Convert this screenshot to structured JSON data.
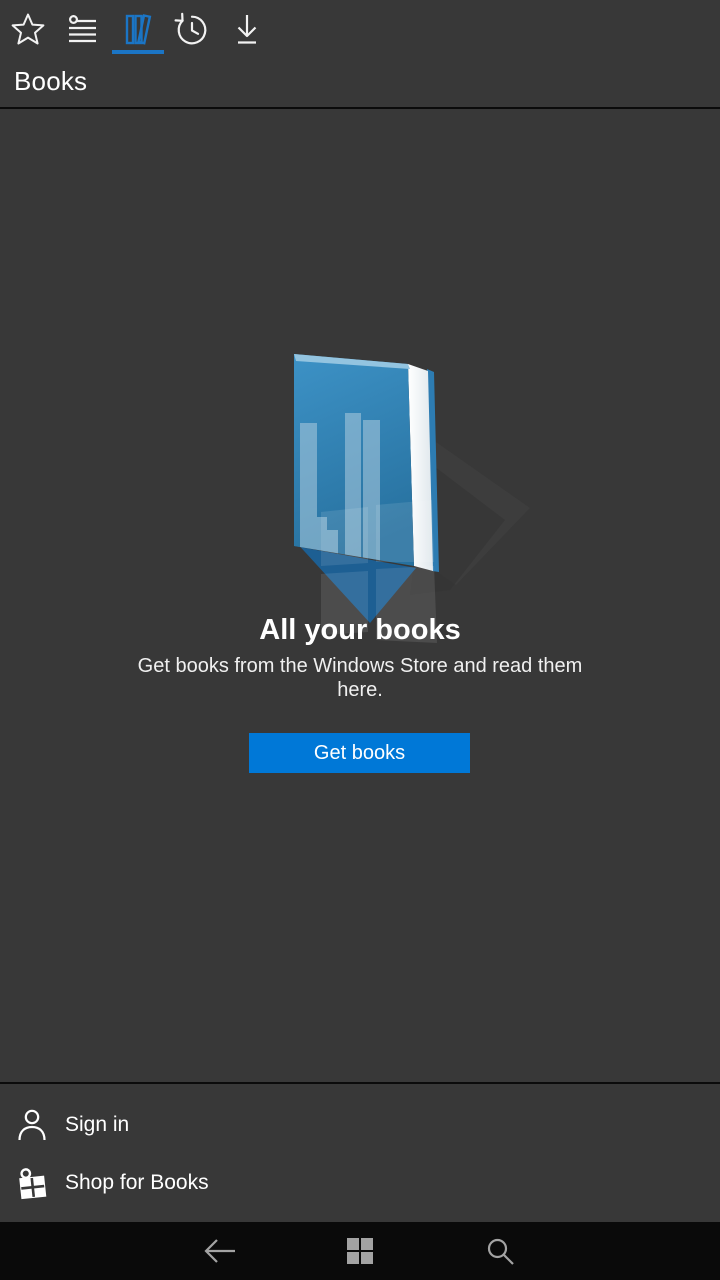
{
  "app": {
    "title": "Books"
  },
  "toolbar": {
    "tabs": [
      {
        "name": "favorites",
        "icon": "star-icon",
        "selected": false
      },
      {
        "name": "reading-list",
        "icon": "reading-list-icon",
        "selected": false
      },
      {
        "name": "books",
        "icon": "books-icon",
        "selected": true
      },
      {
        "name": "history",
        "icon": "history-icon",
        "selected": false
      },
      {
        "name": "downloads",
        "icon": "download-icon",
        "selected": false
      }
    ]
  },
  "empty_state": {
    "title": "All your books",
    "description": "Get books from the Windows Store and read them here.",
    "button_label": "Get books",
    "illustration": "blue-book-with-windows-logo-watermark"
  },
  "footer_menu": {
    "items": [
      {
        "label": "Sign in",
        "icon": "person-icon"
      },
      {
        "label": "Shop for Books",
        "icon": "store-icon"
      }
    ]
  },
  "navbar": {
    "buttons": [
      {
        "name": "back",
        "icon": "back-arrow-icon"
      },
      {
        "name": "start",
        "icon": "windows-logo-icon"
      },
      {
        "name": "search",
        "icon": "search-icon"
      }
    ]
  },
  "colors": {
    "accent_button": "#0078d7",
    "accent_tab": "#1b75c5",
    "background": "#383838",
    "navbar_background": "#0a0a0a",
    "divider": "#0b0b0b",
    "text": "#ffffff",
    "nav_icon": "#a3a3a3"
  }
}
